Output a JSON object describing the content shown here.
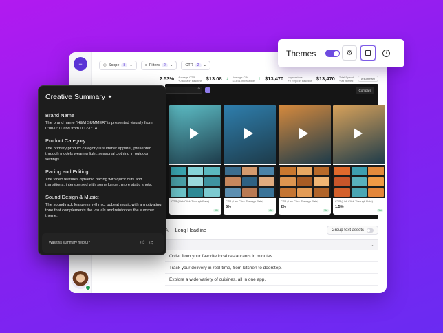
{
  "toolbar": {
    "scope_label": "Scope",
    "scope_count": "8",
    "filters_label": "Filters",
    "filters_count": "2",
    "ctr_label": "CTR",
    "ctr_count": "2"
  },
  "metrics": [
    {
      "value": "2.53%",
      "label": "",
      "sub": ""
    },
    {
      "value": "$13.08",
      "label": "Average CTR",
      "sub": "+0.60ca in baseline"
    },
    {
      "value": "$13,470",
      "label": "Average CPA",
      "sub": "$13.51 in baseline"
    },
    {
      "value": "$13,470",
      "label": "Impressions",
      "sub": "+9 Repo in baseline"
    },
    {
      "value": "",
      "label": "Total Spend",
      "sub": "+ all filtered"
    }
  ],
  "as_summary_label": "A summary",
  "gallery": {
    "compare_label": "Compare",
    "cards": [
      {
        "label": "CTR (Link Click-Through Rate)",
        "value": "",
        "badge": "3%",
        "hero": "#5fc1c9",
        "thumbs": [
          "#3aa4b0",
          "#86d3d8",
          "#5bb8bf",
          "#4a9fa7",
          "#9ad8dc",
          "#3f93a0",
          "#6cc3c9",
          "#2e8995",
          "#7dcad0"
        ]
      },
      {
        "label": "CTR (Link Click-Through Rate)",
        "value": "5%",
        "badge": "4%",
        "hero": "#2f7fae",
        "thumbs": [
          "#3c6e8f",
          "#d49a6d",
          "#4b83a8",
          "#c7875d",
          "#2f6182",
          "#e0ab7f",
          "#5d8fb1",
          "#b97a53",
          "#3a7398"
        ]
      },
      {
        "label": "CTR (Link Click-Through Rate)",
        "value": "2%",
        "badge": "1%",
        "hero": "#d78a3d",
        "thumbs": [
          "#c9782f",
          "#e8a862",
          "#b86a2a",
          "#dd9550",
          "#a85c24",
          "#f0b574",
          "#c47533",
          "#e49c56",
          "#b0642a"
        ]
      },
      {
        "label": "CTR (Link Click-Through Rate)",
        "value": "1.5%",
        "badge": "3%",
        "hero": "#d9a25a",
        "thumbs": [
          "#e06a2c",
          "#3e9fb0",
          "#e48a3c",
          "#c9562a",
          "#58b1bd",
          "#f09a45",
          "#d4602b",
          "#4aa6b4",
          "#e3863a"
        ]
      }
    ]
  },
  "tabs": {
    "a_label": "A",
    "long_headline": "Long Headline",
    "group_text_assets": "Group text assets"
  },
  "rows": [
    "Order from your favorite local restaurants in minutes.",
    "Track your delivery in real-time, from kitchen to doorstep.",
    "Explore a wide variety of cuisines, all in one app."
  ],
  "summary": {
    "title": "Creative Summary",
    "sections": [
      {
        "heading": "Brand Name",
        "text": "The brand name \"H&M SUMMER\" is presented visually from 0:00-0:01 and from 0:12-0:14."
      },
      {
        "heading": "Product Category",
        "text": "The primary product category is summer apparel, presented through models wearing light, seasonal clothing in outdoor settings."
      },
      {
        "heading": "Pacing and Editing",
        "text": "The video features dynamic pacing with quick cuts and transitions, interspersed with some longer, more static shots."
      },
      {
        "heading": "Sound Design & Music:",
        "text": "The soundtrack features rhythmic, upbeat music with a motivating tone that complements the visuals and reinforces the summer theme."
      }
    ],
    "helpful_question": "Was this summary helpful?"
  },
  "themes": {
    "label": "Themes",
    "enabled": true
  },
  "colors": {
    "accent": "#6e4be0",
    "positive": "#1f9d55"
  }
}
